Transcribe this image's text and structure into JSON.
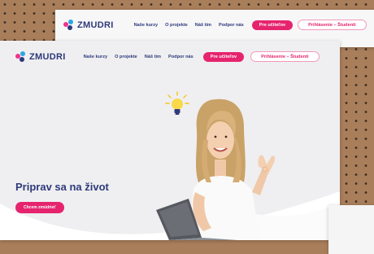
{
  "brand": {
    "name": "ZMUDRI"
  },
  "nav": {
    "links": [
      "Naše kurzy",
      "O projekte",
      "Náš tím",
      "Podpor nás"
    ],
    "teacher_button": "Pre učiteľov",
    "student_button": "Prihlásenie – Študenti"
  },
  "hero": {
    "title": "Priprav sa na život",
    "cta": "Chcem zmúdrieť"
  },
  "icons": {
    "logo": "zmudri-logo-icon",
    "idea": "lightbulb-icon"
  },
  "colors": {
    "accent": "#e6246e",
    "brand_navy": "#2e3a7a",
    "background": "#a97e5b"
  }
}
